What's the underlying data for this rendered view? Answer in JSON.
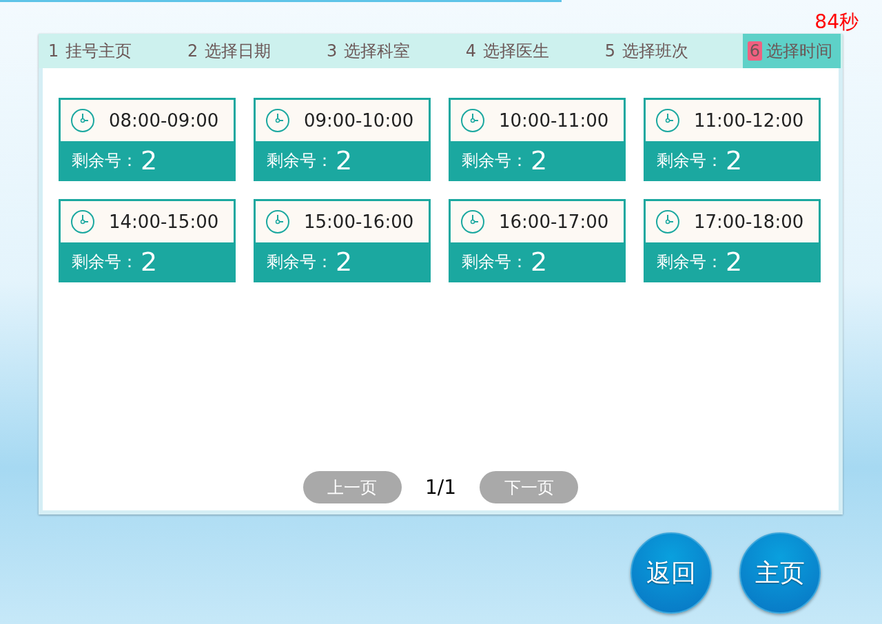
{
  "timer": "84秒",
  "steps": [
    {
      "number": "1",
      "label": "挂号主页",
      "selected": false
    },
    {
      "number": "2",
      "label": "选择日期",
      "selected": false
    },
    {
      "number": "3",
      "label": "选择科室",
      "selected": false
    },
    {
      "number": "4",
      "label": "选择医生",
      "selected": false
    },
    {
      "number": "5",
      "label": "选择班次",
      "selected": false
    },
    {
      "number": "6",
      "label": "选择时间",
      "selected": true
    }
  ],
  "slots": [
    {
      "time": "08:00-09:00",
      "remaining_label": "剩余号：",
      "count": "2"
    },
    {
      "time": "09:00-10:00",
      "remaining_label": "剩余号：",
      "count": "2"
    },
    {
      "time": "10:00-11:00",
      "remaining_label": "剩余号：",
      "count": "2"
    },
    {
      "time": "11:00-12:00",
      "remaining_label": "剩余号：",
      "count": "2"
    },
    {
      "time": "14:00-15:00",
      "remaining_label": "剩余号：",
      "count": "2"
    },
    {
      "time": "15:00-16:00",
      "remaining_label": "剩余号：",
      "count": "2"
    },
    {
      "time": "16:00-17:00",
      "remaining_label": "剩余号：",
      "count": "2"
    },
    {
      "time": "17:00-18:00",
      "remaining_label": "剩余号：",
      "count": "2"
    }
  ],
  "pagination": {
    "prev": "上一页",
    "page": "1/1",
    "next": "下一页"
  },
  "buttons": [
    "返回",
    "主页"
  ]
}
